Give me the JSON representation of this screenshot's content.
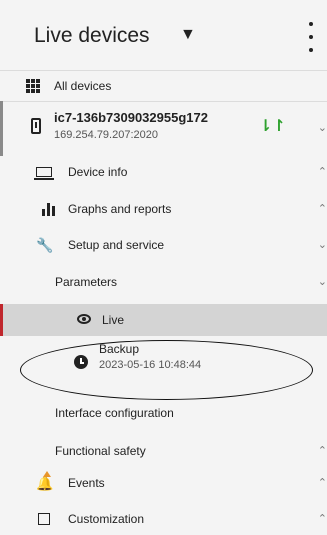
{
  "header": {
    "title": "Live devices",
    "dropdown_icon": "caret-down-icon",
    "menu_icon": "kebab-icon"
  },
  "all_devices": {
    "label": "All devices"
  },
  "device": {
    "name": "ic7-136b7309032955g172",
    "address": "169.254.79.207:2020",
    "status_icon": "sync-arrows-icon"
  },
  "menu": {
    "device_info": "Device info",
    "graphs": "Graphs and reports",
    "setup": "Setup and service",
    "parameters": "Parameters",
    "live": "Live",
    "backup": "Backup",
    "backup_date": "2023-05-16 10:48:44",
    "interface": "Interface configuration",
    "functional_safety": "Functional safety",
    "events": "Events",
    "customization": "Customization"
  },
  "colors": {
    "accent_red": "#c0272d",
    "sync_green": "#2ea12e",
    "warning_orange": "#e8952a",
    "selected_bg": "#d4d4d4"
  }
}
